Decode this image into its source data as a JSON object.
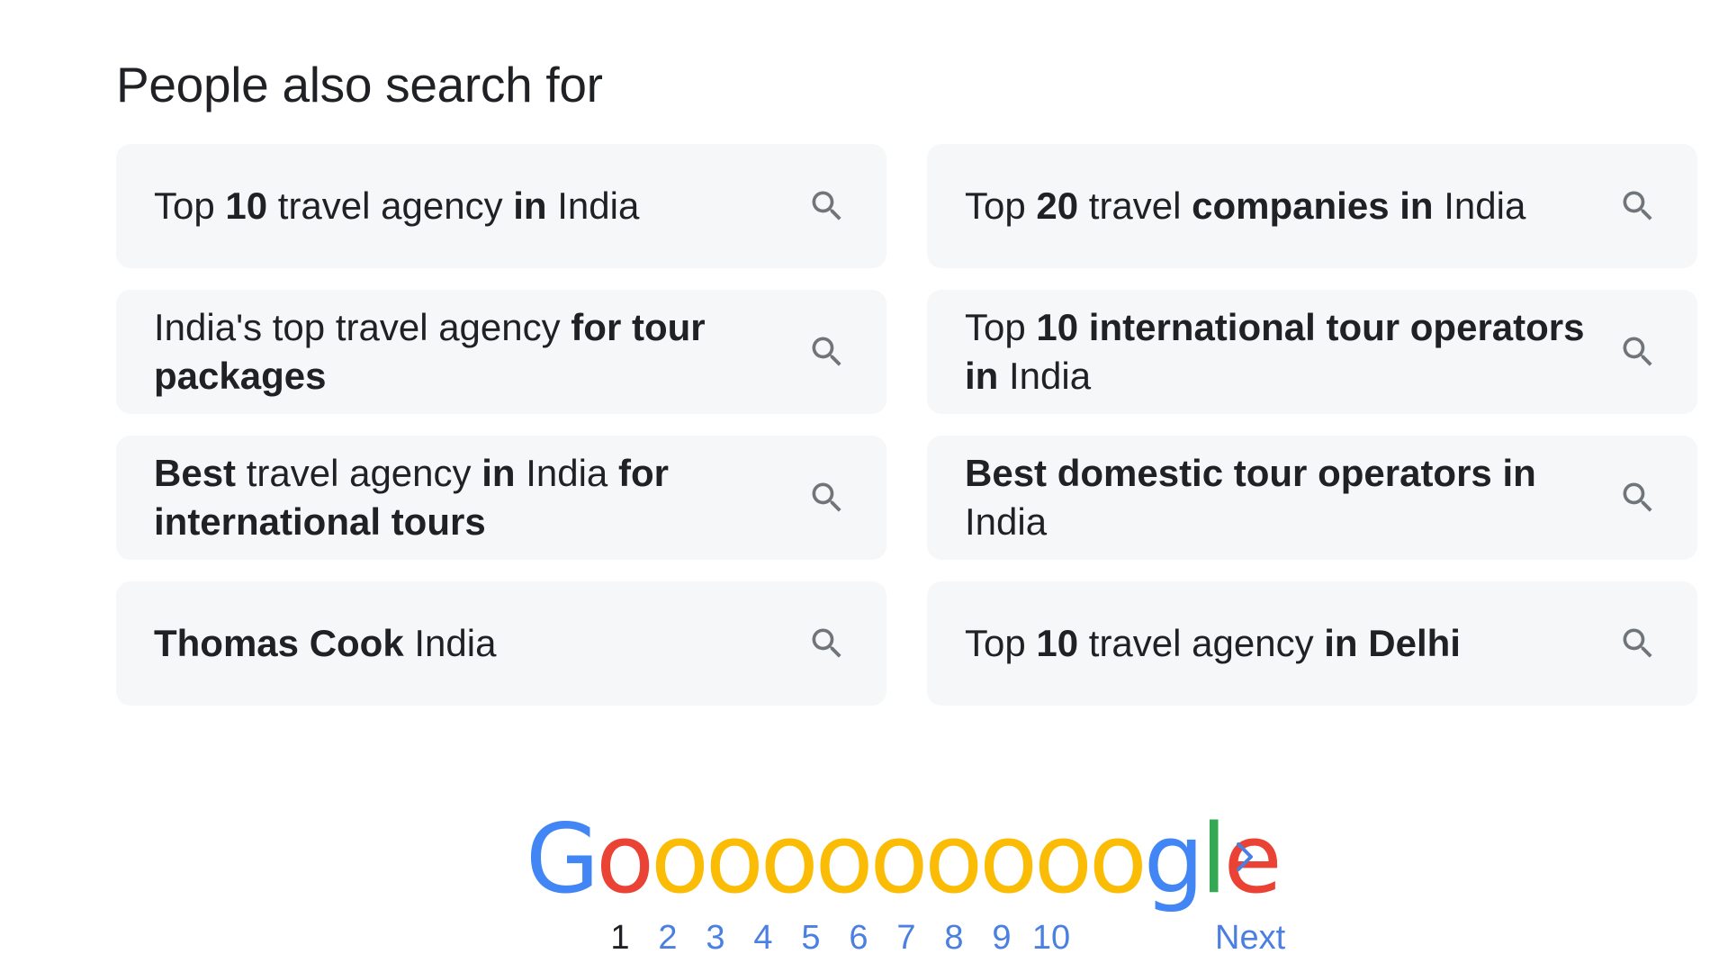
{
  "section": {
    "title": "People also search for",
    "suggestions": [
      {
        "segments": [
          {
            "t": "Top ",
            "b": false
          },
          {
            "t": "10",
            "b": true
          },
          {
            "t": " travel agency ",
            "b": false
          },
          {
            "t": "in",
            "b": true
          },
          {
            "t": " India",
            "b": false
          }
        ]
      },
      {
        "segments": [
          {
            "t": "Top ",
            "b": false
          },
          {
            "t": "20",
            "b": true
          },
          {
            "t": " travel ",
            "b": false
          },
          {
            "t": "companies in",
            "b": true
          },
          {
            "t": " India",
            "b": false
          }
        ]
      },
      {
        "segments": [
          {
            "t": "India's top travel agency ",
            "b": false
          },
          {
            "t": "for tour packages",
            "b": true
          }
        ]
      },
      {
        "segments": [
          {
            "t": "Top ",
            "b": false
          },
          {
            "t": "10 international tour operators in",
            "b": true
          },
          {
            "t": " India",
            "b": false
          }
        ]
      },
      {
        "segments": [
          {
            "t": "Best",
            "b": true
          },
          {
            "t": " travel agency ",
            "b": false
          },
          {
            "t": "in",
            "b": true
          },
          {
            "t": " India ",
            "b": false
          },
          {
            "t": "for international tours",
            "b": true
          }
        ]
      },
      {
        "segments": [
          {
            "t": "Best domestic tour operators in",
            "b": true
          },
          {
            "t": " India",
            "b": false
          }
        ]
      },
      {
        "segments": [
          {
            "t": "Thomas Cook",
            "b": true
          },
          {
            "t": " India",
            "b": false
          }
        ]
      },
      {
        "segments": [
          {
            "t": "Top ",
            "b": false
          },
          {
            "t": "10",
            "b": true
          },
          {
            "t": " travel agency ",
            "b": false
          },
          {
            "t": "in Delhi",
            "b": true
          }
        ]
      }
    ],
    "suggestion_icon": "search-icon"
  },
  "pagination": {
    "logo": {
      "letters": [
        {
          "ch": "G",
          "color": "#4285f4"
        },
        {
          "ch": "o",
          "color": "#ea4335"
        },
        {
          "ch": "o",
          "color": "#fbbc05"
        },
        {
          "ch": "o",
          "color": "#fbbc05"
        },
        {
          "ch": "o",
          "color": "#fbbc05"
        },
        {
          "ch": "o",
          "color": "#fbbc05"
        },
        {
          "ch": "o",
          "color": "#fbbc05"
        },
        {
          "ch": "o",
          "color": "#fbbc05"
        },
        {
          "ch": "o",
          "color": "#fbbc05"
        },
        {
          "ch": "o",
          "color": "#fbbc05"
        },
        {
          "ch": "o",
          "color": "#fbbc05"
        },
        {
          "ch": "g",
          "color": "#4285f4"
        },
        {
          "ch": "l",
          "color": "#34a853"
        },
        {
          "ch": "e",
          "color": "#ea4335"
        }
      ]
    },
    "pages": [
      "1",
      "2",
      "3",
      "4",
      "5",
      "6",
      "7",
      "8",
      "9",
      "10"
    ],
    "current_page": "1",
    "next_label": "Next",
    "next_icon": "chevron-right-icon",
    "link_color": "#4b7fe0"
  }
}
